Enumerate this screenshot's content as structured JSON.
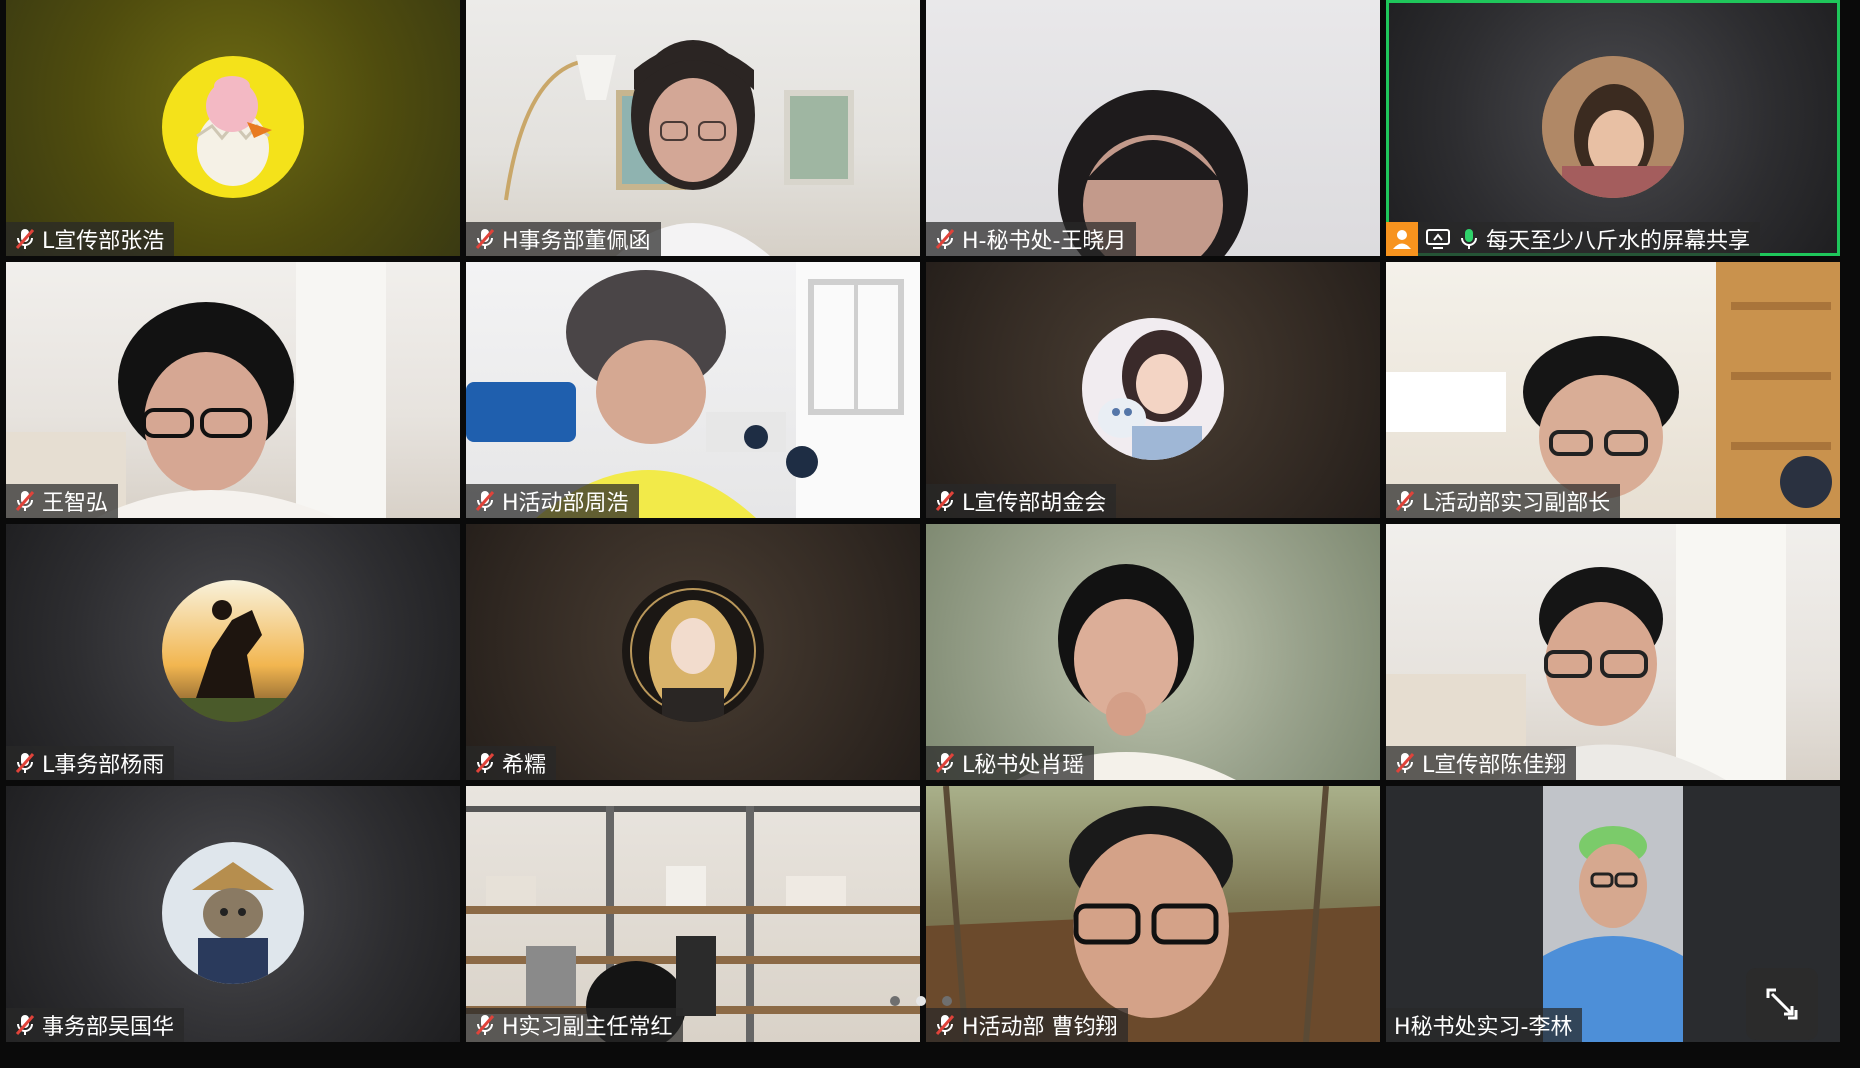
{
  "tiles": [
    {
      "name": "L宣传部张浩",
      "muted": true
    },
    {
      "name": "H事务部董佩函",
      "muted": true
    },
    {
      "name": "H-秘书处-王晓月",
      "muted": true
    },
    {
      "name": "每天至少八斤水的屏幕共享",
      "muted": false,
      "sharing": true
    },
    {
      "name": "王智弘",
      "muted": true
    },
    {
      "name": "H活动部周浩",
      "muted": true
    },
    {
      "name": "L宣传部胡金会",
      "muted": true
    },
    {
      "name": "L活动部实习副部长",
      "muted": true
    },
    {
      "name": "L事务部杨雨",
      "muted": true
    },
    {
      "name": "希糯",
      "muted": true
    },
    {
      "name": "L秘书处肖瑶",
      "muted": true
    },
    {
      "name": "L宣传部陈佳翔",
      "muted": true
    },
    {
      "name": "事务部吴国华",
      "muted": true
    },
    {
      "name": "H实习副主任常红",
      "muted": true
    },
    {
      "name": "H活动部 曹钧翔",
      "muted": true
    },
    {
      "name": "H秘书处实习-李林",
      "muted": false
    }
  ],
  "pagination": {
    "current": 2,
    "total": 3
  },
  "colors": {
    "active_border": "#1fc65b",
    "muted_icon": "#e0433a",
    "share_orange": "#f7931e"
  }
}
